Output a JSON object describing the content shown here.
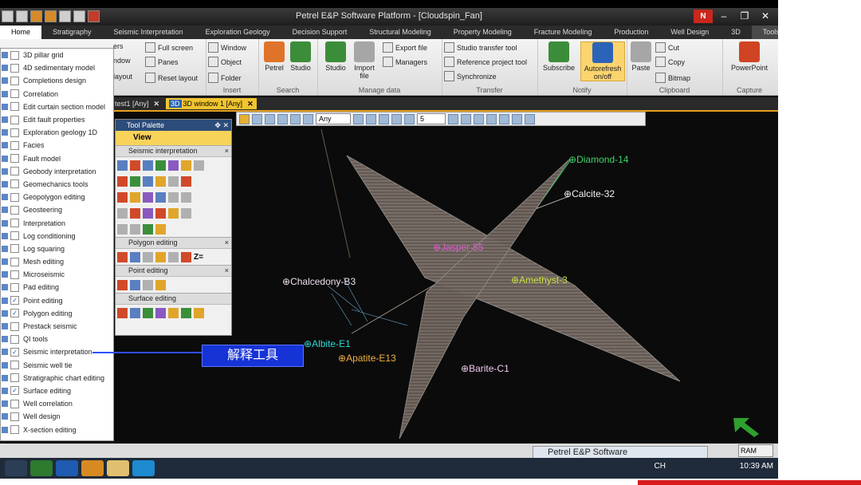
{
  "window": {
    "title": "Petrel E&P Software Platform - [Cloudspin_Fan]",
    "controls": {
      "logo": "N",
      "minimize": "–",
      "restore": "❐",
      "close": "✕"
    }
  },
  "ribbon_tabs": [
    "Home",
    "Stratigraphy",
    "Seismic Interpretation",
    "Exploration Geology",
    "Decision Support",
    "Structural Modeling",
    "Property Modeling",
    "Fracture Modeling",
    "Production",
    "Well Design",
    "3D",
    "Tools"
  ],
  "ribbon": {
    "window_group": {
      "full_screen": "Full screen",
      "panes": "Panes",
      "reset_layout": "Reset layout",
      "layout": "layout",
      "window": "Window",
      "object": "Object",
      "folder": "Folder",
      "tool_layers": "ers",
      "window_partial": "ndow"
    },
    "insert_label": "Insert",
    "search": {
      "petrel": "Petrel",
      "studio": "Studio",
      "label": "Search"
    },
    "manage": {
      "studio": "Studio",
      "import_file": "Import file",
      "export_file": "Export file",
      "managers": "Managers",
      "label": "Manage data"
    },
    "transfer": {
      "studio_transfer": "Studio transfer tool",
      "reference_project": "Reference project tool",
      "synchronize": "Synchronize",
      "label": "Transfer"
    },
    "notify": {
      "subscribe": "Subscribe",
      "autorefresh": "Autorefresh on/off",
      "label": "Notify"
    },
    "clipboard": {
      "paste": "Paste",
      "cut": "Cut",
      "copy": "Copy",
      "bitmap": "Bitmap",
      "label": "Clipboard"
    },
    "capture": {
      "powerpoint": "PowerPoint",
      "label": "Capture"
    }
  },
  "doc_tabs": [
    {
      "label": "test1 [Any]",
      "close": "✕"
    },
    {
      "label": "3D window 1 [Any]",
      "close": "✕",
      "badge": "3D"
    }
  ],
  "view_toolbar": {
    "any_select": "Any",
    "number_select": "5"
  },
  "tools_menu": [
    {
      "label": "3D pillar grid",
      "checked": false
    },
    {
      "label": "4D sedimentary model",
      "checked": false
    },
    {
      "label": "Completions design",
      "checked": false
    },
    {
      "label": "Correlation",
      "checked": false
    },
    {
      "label": "Edit curtain section model",
      "checked": false
    },
    {
      "label": "Edit fault properties",
      "checked": false
    },
    {
      "label": "Exploration geology 1D",
      "checked": false
    },
    {
      "label": "Facies",
      "checked": false
    },
    {
      "label": "Fault model",
      "checked": false
    },
    {
      "label": "Geobody interpretation",
      "checked": false
    },
    {
      "label": "Geomechanics tools",
      "checked": false
    },
    {
      "label": "Geopolygon editing",
      "checked": false
    },
    {
      "label": "Geosteering",
      "checked": false
    },
    {
      "label": "Interpretation",
      "checked": false
    },
    {
      "label": "Log conditioning",
      "checked": false
    },
    {
      "label": "Log squaring",
      "checked": false
    },
    {
      "label": "Mesh editing",
      "checked": false
    },
    {
      "label": "Microseismic",
      "checked": false
    },
    {
      "label": "Pad editing",
      "checked": false
    },
    {
      "label": "Point editing",
      "checked": true
    },
    {
      "label": "Polygon editing",
      "checked": true
    },
    {
      "label": "Prestack seismic",
      "checked": false
    },
    {
      "label": "QI tools",
      "checked": false
    },
    {
      "label": "Seismic interpretation",
      "checked": true
    },
    {
      "label": "Seismic well tie",
      "checked": false
    },
    {
      "label": "Stratigraphic chart editing",
      "checked": false
    },
    {
      "label": "Surface editing",
      "checked": true
    },
    {
      "label": "Well correlation",
      "checked": false
    },
    {
      "label": "Well design",
      "checked": false
    },
    {
      "label": "X-section editing",
      "checked": false
    }
  ],
  "check_mark": "✓",
  "palette": {
    "title": "Tool Palette",
    "pin": "✥ ✕",
    "view": "View",
    "close": "×",
    "sections": [
      "Seismic interpretation",
      "Polygon editing",
      "Point editing",
      "Surface editing"
    ],
    "z_label": "Z="
  },
  "wells": [
    {
      "name": "Diamond-14",
      "color": "#3fd36a"
    },
    {
      "name": "Calcite-32",
      "color": "#f0f0f0"
    },
    {
      "name": "Jasper-55",
      "color": "#e05ad0"
    },
    {
      "name": "Amethyst-3",
      "color": "#c8e040"
    },
    {
      "name": "Chalcedony-B3",
      "color": "#f0e0f0"
    },
    {
      "name": "Albite-E1",
      "color": "#30d6d6"
    },
    {
      "name": "Apatite-E13",
      "color": "#f0b040"
    },
    {
      "name": "Barite-C1",
      "color": "#f0c8f0"
    }
  ],
  "callout": "解释工具",
  "taskbar": {
    "petrel_task": "Petrel E&P Software",
    "ram": "RAM",
    "time": "10:39 AM",
    "lang": "CH"
  },
  "colors": {
    "palette_title": "#2c4d7a",
    "view_header": "#f8d35a",
    "callout": "#1633d6",
    "accent_tab": "#f2c430"
  }
}
